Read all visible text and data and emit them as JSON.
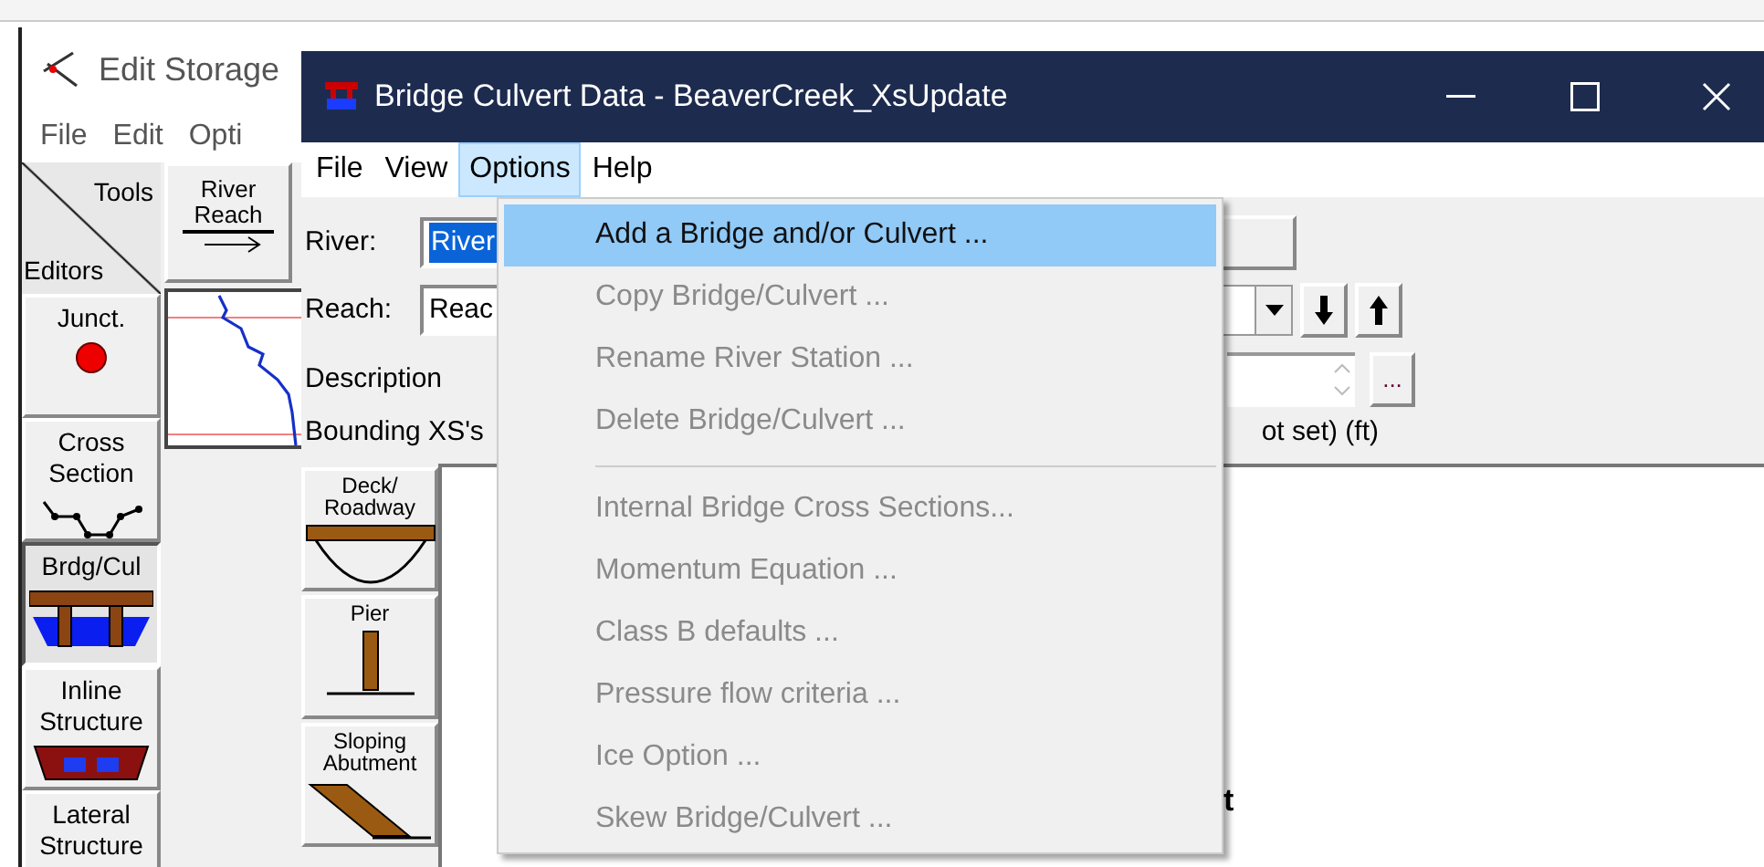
{
  "background_window": {
    "title": "Edit Storage",
    "menu": [
      "File",
      "Edit",
      "Opti"
    ],
    "tools_label": "Tools",
    "editors_label": "Editors",
    "river_reach_button": {
      "lines": [
        "River",
        "Reach"
      ]
    },
    "editors": [
      {
        "lines": [
          "Junct."
        ],
        "kind": "junction",
        "selected": false
      },
      {
        "lines": [
          "Cross",
          "Section"
        ],
        "kind": "cross_section",
        "selected": false
      },
      {
        "lines": [
          "Brdg/Cul"
        ],
        "kind": "bridge",
        "selected": true
      },
      {
        "lines": [
          "Inline",
          "Structure"
        ],
        "kind": "inline",
        "selected": false
      },
      {
        "lines": [
          "Lateral",
          "Structure"
        ],
        "kind": "lateral",
        "selected": false
      }
    ]
  },
  "window": {
    "title": "Bridge Culvert Data - BeaverCreek_XsUpdate",
    "menu": [
      {
        "label": "File",
        "selected": false
      },
      {
        "label": "View",
        "selected": false
      },
      {
        "label": "Options",
        "selected": true
      },
      {
        "label": "Help",
        "selected": false
      }
    ],
    "river_label": "River:",
    "river_value": "River",
    "reach_label": "Reach:",
    "reach_value": "Reac",
    "description_label": "Description",
    "bounding_label": "Bounding XS's",
    "bounding_note": "ot set) (ft)",
    "description_button": "...",
    "tabs": [
      {
        "lines": [
          "Deck/",
          "Roadway"
        ],
        "kind": "deck"
      },
      {
        "lines": [
          "Pier"
        ],
        "kind": "pier"
      },
      {
        "lines": [
          "Sloping",
          "Abutment"
        ],
        "kind": "abutment"
      }
    ],
    "panel_text": "t"
  },
  "options_menu": [
    {
      "kind": "item",
      "label": "Add a Bridge and/or Culvert ...",
      "disabled": false,
      "selected": true
    },
    {
      "kind": "item",
      "label": "Copy Bridge/Culvert ...",
      "disabled": true,
      "selected": false
    },
    {
      "kind": "item",
      "label": "Rename River Station ...",
      "disabled": true,
      "selected": false
    },
    {
      "kind": "item",
      "label": "Delete Bridge/Culvert ...",
      "disabled": true,
      "selected": false
    },
    {
      "kind": "separator"
    },
    {
      "kind": "item",
      "label": "Internal Bridge Cross Sections...",
      "disabled": true,
      "selected": false
    },
    {
      "kind": "item",
      "label": "Momentum Equation ...",
      "disabled": true,
      "selected": false
    },
    {
      "kind": "item",
      "label": "Class B defaults ...",
      "disabled": true,
      "selected": false
    },
    {
      "kind": "item",
      "label": "Pressure flow criteria ...",
      "disabled": true,
      "selected": false
    },
    {
      "kind": "item",
      "label": "Ice Option ...",
      "disabled": true,
      "selected": false
    },
    {
      "kind": "item",
      "label": "Skew Bridge/Culvert ...",
      "disabled": true,
      "selected": false
    }
  ]
}
